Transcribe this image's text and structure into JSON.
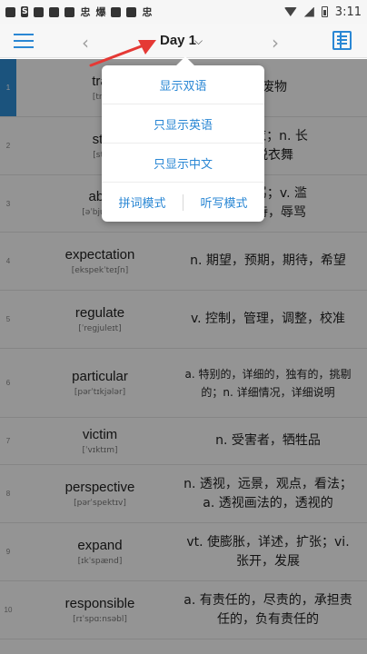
{
  "status_bar": {
    "left_icons": [
      "app-icon-s",
      "app-icon-square",
      "app-icon-square",
      "app-icon-boxed",
      "app-icon-glyph",
      "app-icon-glyph",
      "app-icon-square",
      "app-icon-square",
      "app-icon-glyph"
    ],
    "badge_s": "S",
    "glyph_a": "忠",
    "glyph_b": "爆",
    "glyph_c": "忠",
    "time": "3:11"
  },
  "header": {
    "title": "Day 1",
    "prev_label": "‹",
    "next_label": "›",
    "caret": "⌵"
  },
  "words": [
    {
      "num": "1",
      "word": "tra",
      "phonetic": "[tra",
      "meaning": "，废物"
    },
    {
      "num": "2",
      "word": "str",
      "phonetic": "[str",
      "meaning": "，脱衣；n. 长\n，脱衣舞"
    },
    {
      "num": "3",
      "word": "abu",
      "phonetic": "[əˈbjuːs ]",
      "meaning": "，辱骂；v. 滥\n，虐待，辱骂"
    },
    {
      "num": "4",
      "word": "expectation",
      "phonetic": "[ekspekˈteɪʃn]",
      "meaning": "n. 期望，预期，期待，希望"
    },
    {
      "num": "5",
      "word": "regulate",
      "phonetic": "[ˈregjuleɪt]",
      "meaning": "v. 控制，管理，调整，校准"
    },
    {
      "num": "6",
      "word": "particular",
      "phonetic": "[pərˈtɪkjələr]",
      "meaning": "a. 特别的，详细的，独有的，挑剔的；n. 详细情况，详细说明"
    },
    {
      "num": "7",
      "word": "victim",
      "phonetic": "[ˈvɪktɪm]",
      "meaning": "n. 受害者，牺牲品"
    },
    {
      "num": "8",
      "word": "perspective",
      "phonetic": "[pərˈspektɪv]",
      "meaning": "n. 透视，远景，观点，看法；a. 透视画法的，透视的"
    },
    {
      "num": "9",
      "word": "expand",
      "phonetic": "[ɪkˈspænd]",
      "meaning": "vt. 使膨胀，详述，扩张；vi. 张开，发展"
    },
    {
      "num": "10",
      "word": "responsible",
      "phonetic": "[rɪˈspɑːnsəbl]",
      "meaning": "a. 有责任的，尽责的，承担责任的，负有责任的"
    }
  ],
  "popup": {
    "options": [
      "显示双语",
      "只显示英语",
      "只显示中文"
    ],
    "mode_spelling": "拼词模式",
    "mode_dictation": "听写模式"
  },
  "colors": {
    "accent": "#2a87d4",
    "arrow": "#e53935",
    "selected_row": "#2f8fd8"
  }
}
